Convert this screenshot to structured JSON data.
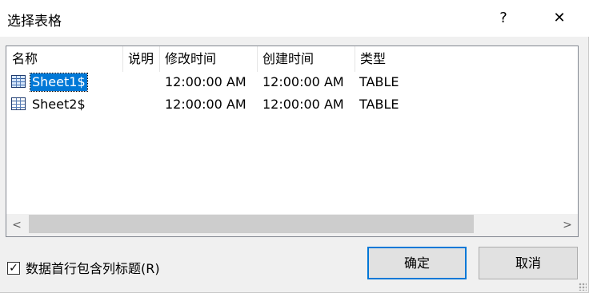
{
  "window": {
    "title": "选择表格",
    "help_label": "?",
    "close_label": "✕"
  },
  "columns": [
    "名称",
    "说明",
    "修改时间",
    "创建时间",
    "类型"
  ],
  "rows": [
    {
      "name": "Sheet1$",
      "description": "",
      "modified": "12:00:00 AM",
      "created": "12:00:00 AM",
      "type": "TABLE",
      "selected": true
    },
    {
      "name": "Sheet2$",
      "description": "",
      "modified": "12:00:00 AM",
      "created": "12:00:00 AM",
      "type": "TABLE",
      "selected": false
    }
  ],
  "scrollbar": {
    "left_arrow": "<",
    "right_arrow": ">"
  },
  "first_row_headers": {
    "label": "数据首行包含列标题(R)",
    "checked": true,
    "check_glyph": "✓"
  },
  "buttons": {
    "ok": "确定",
    "cancel": "取消"
  },
  "colors": {
    "selection": "#0078d7",
    "default_button_border": "#0078d7"
  }
}
